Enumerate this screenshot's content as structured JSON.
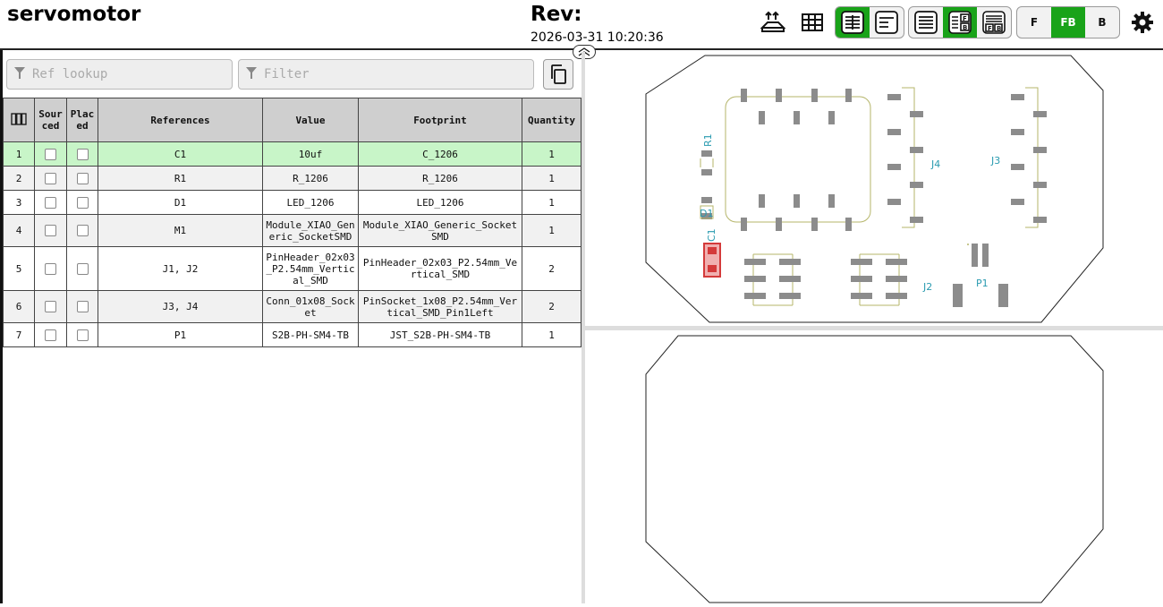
{
  "header": {
    "title": "servomotor",
    "rev_label": "Rev:",
    "rev_date": "2026-03-31 10:20:36"
  },
  "toolbar": {
    "icons": [
      "upload-icon",
      "grid-icon",
      "bom-left-drawings-right-icon",
      "bom-top-drawings-bottom-icon"
    ],
    "view_group": [
      "bom-only-icon",
      "bom-left-fb-right-icon",
      "bom-top-fb-bottom-icon"
    ],
    "layers": [
      "F",
      "FB",
      "B"
    ],
    "active_layer": "FB",
    "settings_icon": "gear-icon"
  },
  "filters": {
    "ref_placeholder": "Ref lookup",
    "filter_placeholder": "Filter"
  },
  "bom": {
    "columns": [
      "",
      "Sourced",
      "Placed",
      "References",
      "Value",
      "Footprint",
      "Quantity"
    ],
    "column_labels": {
      "sourced": "Sour\nced",
      "placed": "Plac\ned",
      "references": "References",
      "value": "Value",
      "footprint": "Footprint",
      "quantity": "Quantity"
    },
    "rows": [
      {
        "num": "1",
        "refs": "C1",
        "value": "10uf",
        "footprint": "C_1206",
        "qty": "1"
      },
      {
        "num": "2",
        "refs": "R1",
        "value": "R_1206",
        "footprint": "R_1206",
        "qty": "1"
      },
      {
        "num": "3",
        "refs": "D1",
        "value": "LED_1206",
        "footprint": "LED_1206",
        "qty": "1"
      },
      {
        "num": "4",
        "refs": "M1",
        "value": "Module_XIAO_Generic_SocketSMD",
        "footprint": "Module_XIAO_Generic_SocketSMD",
        "qty": "1"
      },
      {
        "num": "5",
        "refs": "J1, J2",
        "value": "PinHeader_02x03_P2.54mm_Vertical_SMD",
        "footprint": "PinHeader_02x03_P2.54mm_Vertical_SMD",
        "qty": "2"
      },
      {
        "num": "6",
        "refs": "J3, J4",
        "value": "Conn_01x08_Socket",
        "footprint": "PinSocket_1x08_P2.54mm_Vertical_SMD_Pin1Left",
        "qty": "2"
      },
      {
        "num": "7",
        "refs": "P1",
        "value": "S2B-PH-SM4-TB",
        "footprint": "JST_S2B-PH-SM4-TB",
        "qty": "1"
      }
    ]
  },
  "pcb": {
    "front_labels": {
      "r1": "R1",
      "d1": "D1",
      "c1": "C1",
      "j4": "J4",
      "j3": "J3",
      "j2": "J2",
      "p1": "P1"
    },
    "colors": {
      "silk_label": "#2a9bb0",
      "pad": "#8c8c8c",
      "highlight": "#d43a3a",
      "outline": "#222222",
      "fab": "#b5b56a",
      "accent": "#19a319"
    }
  }
}
